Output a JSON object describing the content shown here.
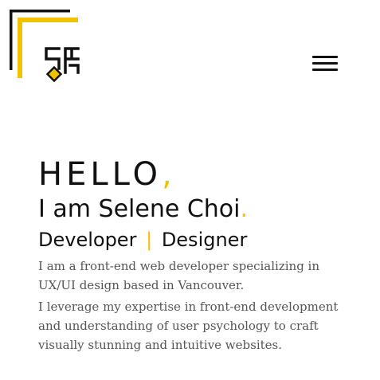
{
  "header": {
    "logo_icon": "sc-monogram-logo-icon",
    "menu_icon": "hamburger-menu-icon"
  },
  "hero": {
    "greeting": "HELLO",
    "greeting_mark": ",",
    "name_line": "I am Selene Choi",
    "name_mark": ".",
    "role_1": "Developer",
    "role_separator": "|",
    "role_2": "Designer",
    "bio_1": "I am a front-end web developer specializing in UX/UI design based in Vancouver.",
    "bio_2": "I leverage my expertise in front-end development and understanding of user psychology to craft visually stunning and intuitive websites."
  },
  "colors": {
    "accent": "#f2c200",
    "text": "#111111",
    "body_text": "#555555",
    "background": "#ffffff"
  }
}
